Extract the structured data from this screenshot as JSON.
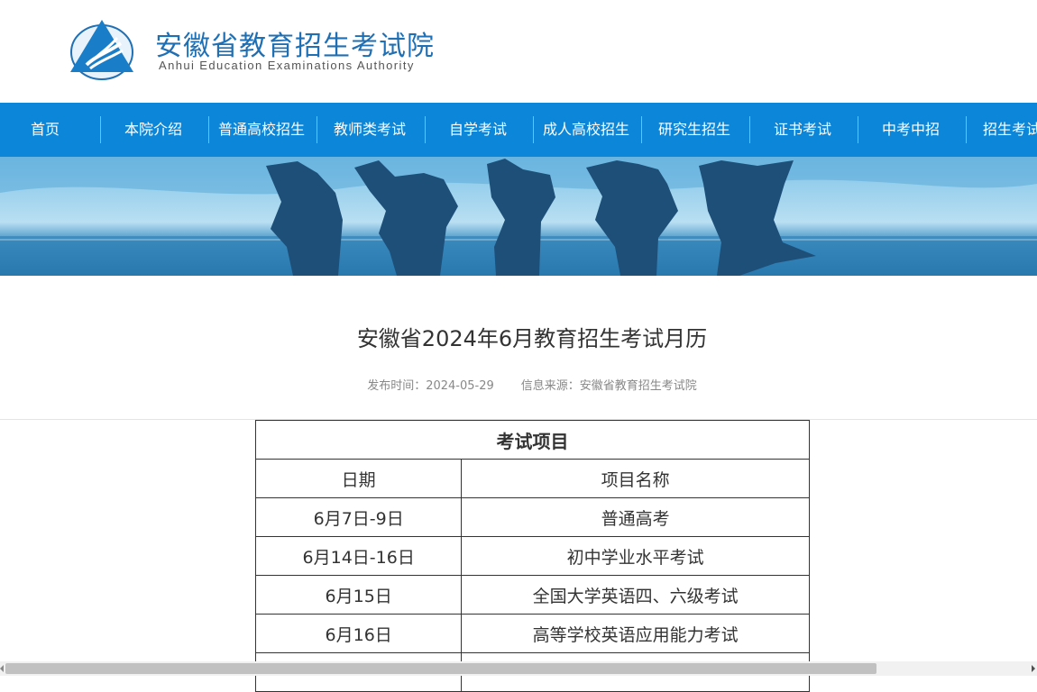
{
  "header": {
    "logo_cn": "安徽省教育招生考试院",
    "logo_en": "Anhui Education Examinations Authority",
    "brand_color": "#1f6fb4"
  },
  "nav": {
    "color": "#0b86d8",
    "items": [
      {
        "label": "首页"
      },
      {
        "label": "本院介绍"
      },
      {
        "label": "普通高校招生"
      },
      {
        "label": "教师类考试"
      },
      {
        "label": "自学考试"
      },
      {
        "label": "成人高校招生"
      },
      {
        "label": "研究生招生"
      },
      {
        "label": "证书考试"
      },
      {
        "label": "中考中招"
      },
      {
        "label": "招生考试咨"
      }
    ]
  },
  "article": {
    "title": "安徽省2024年6月教育招生考试月历",
    "publish_label": "发布时间：",
    "publish_date": "2024-05-29",
    "source_label": "信息来源：",
    "source": "安徽省教育招生考试院"
  },
  "table": {
    "heading": "考试项目",
    "columns": [
      "日期",
      "项目名称"
    ],
    "rows": [
      {
        "date": "6月7日-9日",
        "name": "普通高考"
      },
      {
        "date": "6月14日-16日",
        "name": "初中学业水平考试"
      },
      {
        "date": "6月15日",
        "name": "全国大学英语四、六级考试"
      },
      {
        "date": "6月16日",
        "name": "高等学校英语应用能力考试"
      },
      {
        "date": "",
        "name": ""
      }
    ]
  }
}
